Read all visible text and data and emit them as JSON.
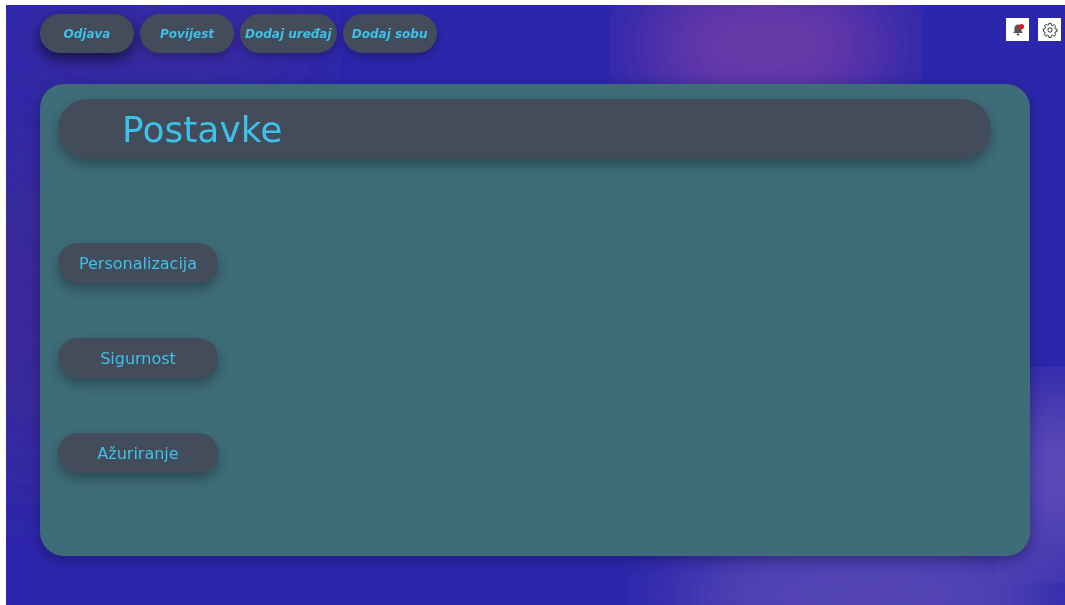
{
  "nav": [
    {
      "label": "Odjava"
    },
    {
      "label": "Povijest"
    },
    {
      "label": "Dodaj uređaj"
    },
    {
      "label": "Dodaj sobu"
    }
  ],
  "notifications": {
    "unread": true
  },
  "settings": {
    "title": "Postavke",
    "sections": [
      {
        "label": "Personalizacija"
      },
      {
        "label": "Sigurnost"
      },
      {
        "label": "Ažuriranje"
      }
    ]
  }
}
